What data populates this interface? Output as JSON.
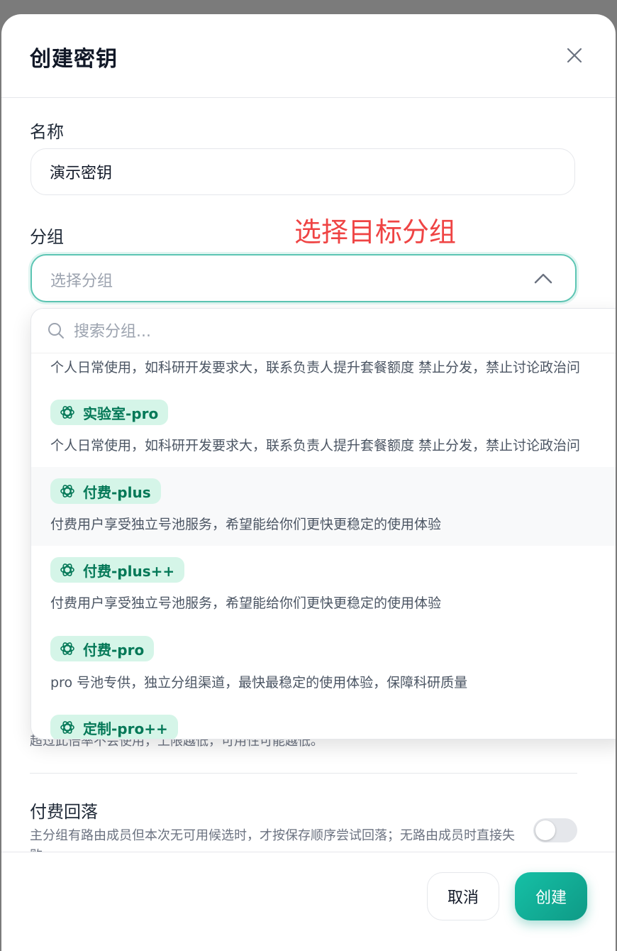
{
  "modal": {
    "title": "创建密钥",
    "name_label": "名称",
    "name_value": "演示密钥",
    "group_label": "分组",
    "annotation": "选择目标分组",
    "group_placeholder": "选择分组"
  },
  "dropdown": {
    "search_placeholder": "搜索分组...",
    "items": [
      {
        "tag": "",
        "desc": "个人日常使用，如科研开发要求大，联系负责人提升套餐额度 禁止分发，禁止讨论政治问"
      },
      {
        "tag": "实验室-pro",
        "desc": "个人日常使用，如科研开发要求大，联系负责人提升套餐额度 禁止分发，禁止讨论政治问"
      },
      {
        "tag": "付费-plus",
        "desc": "付费用户享受独立号池服务，希望能给你们更快更稳定的使用体验"
      },
      {
        "tag": "付费-plus++",
        "desc": "付费用户享受独立号池服务，希望能给你们更快更稳定的使用体验"
      },
      {
        "tag": "付费-pro",
        "desc": "pro 号池专供，独立分组渠道，最快最稳定的使用体验，保障科研质量"
      },
      {
        "tag": "定制-pro++",
        "desc": ""
      }
    ]
  },
  "hint_text": "超过此倍率不会使用，上限越低，可用性可能越低。",
  "fallback": {
    "title": "付费回落",
    "desc": "主分组有路由成员但本次无可用候选时，才按保存顺序尝试回落；无路由成员时直接失败。",
    "toggle_on": false
  },
  "footer": {
    "cancel_label": "取消",
    "create_label": "创建"
  },
  "colors": {
    "accent": "#14b8a6",
    "tag_bg": "#d5f5e8",
    "tag_text": "#047857",
    "annotation": "#ef4444"
  }
}
